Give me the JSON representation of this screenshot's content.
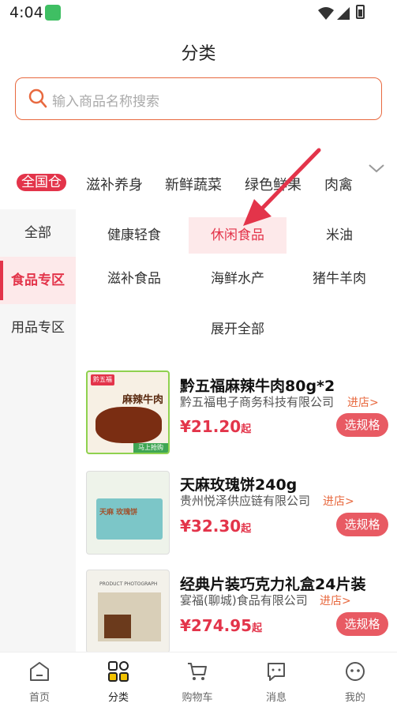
{
  "status": {
    "time": "4:04"
  },
  "header": {
    "title": "分类"
  },
  "search": {
    "placeholder": "输入商品名称搜索"
  },
  "tabs": [
    {
      "label": "全国仓"
    },
    {
      "label": "滋补养身"
    },
    {
      "label": "新鲜蔬菜"
    },
    {
      "label": "绿色鲜果"
    },
    {
      "label": "肉禽"
    }
  ],
  "sidebar": {
    "items": [
      {
        "label": "全部"
      },
      {
        "label": "食品专区"
      },
      {
        "label": "用品专区"
      }
    ]
  },
  "subcategories": [
    {
      "label": "健康轻食"
    },
    {
      "label": "休闲食品"
    },
    {
      "label": "米油"
    },
    {
      "label": "滋补食品"
    },
    {
      "label": "海鲜水产"
    },
    {
      "label": "猪牛羊肉"
    },
    {
      "label": "展开全部"
    }
  ],
  "products": [
    {
      "name": "黔五福麻辣牛肉80g*2",
      "shop": "黔五福电子商务科技有限公司",
      "link": "进店>",
      "price": "¥21.20",
      "suffix": "起",
      "button": "选规格",
      "img_text": "麻辣牛肉",
      "img_tag": "黔五福",
      "img_badge": "马上抢购"
    },
    {
      "name": "天麻玫瑰饼240g",
      "shop": "贵州悦泽供应链有限公司",
      "link": "进店>",
      "price": "¥32.30",
      "suffix": "起",
      "button": "选规格",
      "img_text": "天麻 玫瑰饼"
    },
    {
      "name": "经典片装巧克力礼盒24片装",
      "shop": "宴福(聊城)食品有限公司",
      "link": "进店>",
      "price": "¥274.95",
      "suffix": "起",
      "button": "选规格",
      "img_text": "PRODUCT PHOTOGRAPH"
    }
  ],
  "nav": [
    {
      "label": "首页"
    },
    {
      "label": "分类"
    },
    {
      "label": "购物车"
    },
    {
      "label": "消息"
    },
    {
      "label": "我的"
    }
  ],
  "colors": {
    "accent": "#e3344a",
    "search_border": "#e8693f",
    "button": "#e85a63"
  }
}
